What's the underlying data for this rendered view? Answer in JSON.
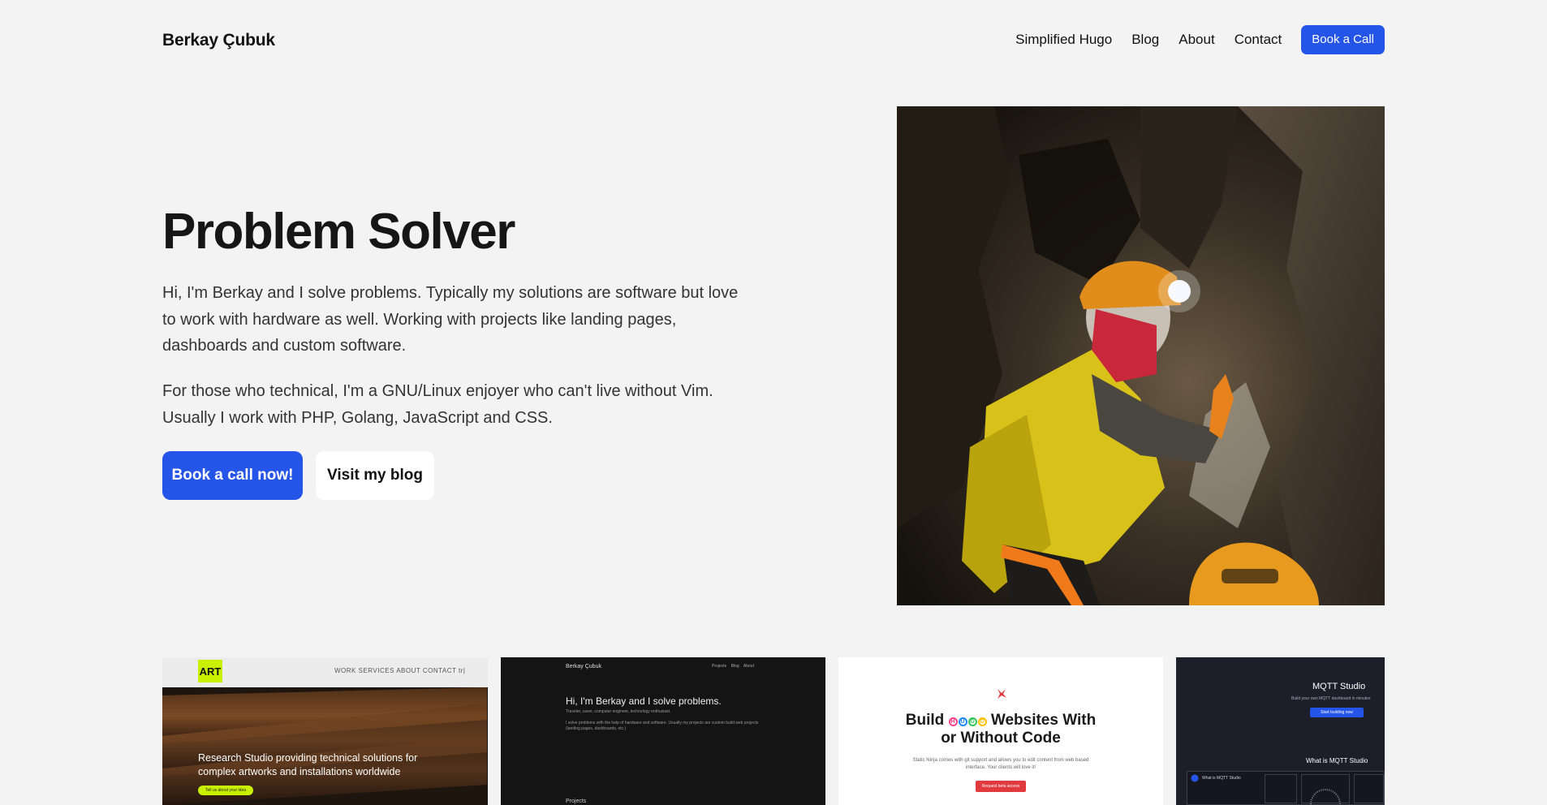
{
  "header": {
    "brand": "Berkay Çubuk",
    "nav": [
      "Simplified Hugo",
      "Blog",
      "About",
      "Contact"
    ],
    "cta": "Book a Call"
  },
  "hero": {
    "title": "Problem Solver",
    "p1": "Hi, I'm Berkay and I solve problems. Typically my solutions are software but love to work with hardware as well. Working with projects like landing pages, dashboards and custom software.",
    "p2": "For those who technical, I'm a GNU/Linux enjoyer who can't live without Vim. Usually I work with PHP, Golang, JavaScript and CSS.",
    "primary_button": "Book a call now!",
    "secondary_button": "Visit my blog"
  },
  "projects": {
    "art": {
      "logo": "ART",
      "nav": "WORK  SERVICES  ABOUT  CONTACT  tr|",
      "headline": "Research Studio providing technical solutions for complex artworks and installations worldwide",
      "cta": "Tell us about your idea"
    },
    "personal": {
      "brand": "Berkay Çubuk",
      "nav": "Projects    Blog    About",
      "heading": "Hi, I'm Berkay and I solve problems.",
      "sub": "Traveler, caver, computer engineer, technology enthusiast.",
      "body": "I solve problems with the help of hardware and software. Usually my projects are custom build web projects (landing pages, dashboards, etc.)",
      "section": "Projects"
    },
    "hugo": {
      "title_pre": "Build",
      "hugo_letters": [
        "H",
        "U",
        "G",
        "O"
      ],
      "title_post": "Websites With",
      "title_line2": "or Without Code",
      "sub": "Static Ninja comes with git support and allows you to edit content from web based interface. Your clients will love it!",
      "cta": "Request beta access"
    },
    "mqtt": {
      "title": "MQTT Studio",
      "sub": "Build your own MQTT dashboard in minutes",
      "cta": "Start building now",
      "section": "What is MQTT Studio",
      "panel": "What is MQTT Studio"
    }
  },
  "colors": {
    "accent": "#2554e8",
    "background": "#f3f3f3",
    "art_lime": "#c8f000",
    "hugo_pink": "#ff4088",
    "hugo_blue": "#1b87ff",
    "hugo_green": "#34c759",
    "hugo_yellow": "#ffbf00",
    "static_red": "#e0393e"
  }
}
